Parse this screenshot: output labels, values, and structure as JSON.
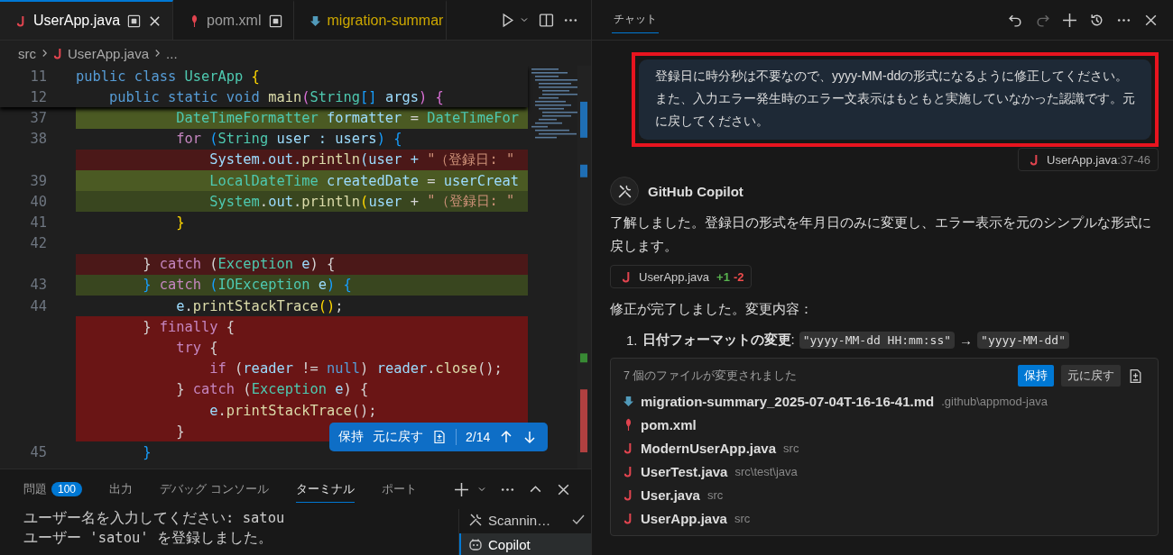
{
  "editor": {
    "tabs": [
      {
        "label": "UserApp.java",
        "kind": "java",
        "selected": true,
        "dirty": true,
        "closable": true
      },
      {
        "label": "pom.xml",
        "kind": "maven",
        "selected": false,
        "dirty": true,
        "closable": false
      },
      {
        "label": "migration-summar",
        "kind": "markdown",
        "selected": false,
        "dirty": false,
        "closable": false
      }
    ],
    "breadcrumb": {
      "folder": "src",
      "file": "UserApp.java",
      "more": "..."
    },
    "sticky_lines": [
      {
        "number": "11",
        "code": [
          {
            "text": "public class ",
            "kind": "kw"
          },
          {
            "text": "UserApp ",
            "kind": "type"
          },
          {
            "text": "{",
            "kind": "b1"
          }
        ]
      },
      {
        "number": "12",
        "code": [
          {
            "text": "    public static void ",
            "kind": "kw"
          },
          {
            "text": "main",
            "kind": "fn"
          },
          {
            "text": "(",
            "kind": "b2"
          },
          {
            "text": "String",
            "kind": "type"
          },
          {
            "text": "[]",
            "kind": "b3"
          },
          {
            "text": " args",
            "kind": "var"
          },
          {
            "text": ")",
            "kind": "b2"
          },
          {
            "text": " {",
            "kind": "b2"
          }
        ]
      }
    ],
    "lines": [
      {
        "number": "37",
        "kind": "added",
        "code": [
          {
            "text": "            DateTimeFormatter",
            "kind": "type"
          },
          {
            "text": " formatter",
            "kind": "var"
          },
          {
            "text": " = ",
            "kind": "punct"
          },
          {
            "text": "DateTimeFor",
            "kind": "type"
          }
        ]
      },
      {
        "number": "38",
        "code": [
          {
            "text": "            for ",
            "kind": "ctrl"
          },
          {
            "text": "(",
            "kind": "b3"
          },
          {
            "text": "String",
            "kind": "type"
          },
          {
            "text": " user : users",
            "kind": "var"
          },
          {
            "text": ") {",
            "kind": "b3"
          }
        ]
      },
      {
        "kind": "removed",
        "code": [
          {
            "text": "                System.out.",
            "kind": "var"
          },
          {
            "text": "println",
            "kind": "fn"
          },
          {
            "text": "(user + ",
            "kind": "var"
          },
          {
            "text": "\"（登録日: \"",
            "kind": "str"
          }
        ]
      },
      {
        "number": "39",
        "kind": "added",
        "code": [
          {
            "text": "                LocalDateTime",
            "kind": "type"
          },
          {
            "text": " createdDate",
            "kind": "var"
          },
          {
            "text": " = ",
            "kind": "punct"
          },
          {
            "text": "userCreat",
            "kind": "var"
          }
        ]
      },
      {
        "number": "40",
        "kind": "added-dim",
        "code": [
          {
            "text": "                System",
            "kind": "type"
          },
          {
            "text": ".",
            "kind": "punct"
          },
          {
            "text": "out",
            "kind": "var"
          },
          {
            "text": ".",
            "kind": "punct"
          },
          {
            "text": "println",
            "kind": "fn"
          },
          {
            "text": "(",
            "kind": "b1"
          },
          {
            "text": "user",
            "kind": "var"
          },
          {
            "text": " + ",
            "kind": "punct"
          },
          {
            "text": "\"（登録日: \"",
            "kind": "str"
          }
        ]
      },
      {
        "number": "41",
        "code": [
          {
            "text": "            }",
            "kind": "b1"
          }
        ]
      },
      {
        "number": "42"
      },
      {
        "kind": "removed",
        "code": [
          {
            "text": "        } ",
            "kind": "punct"
          },
          {
            "text": "catch",
            "kind": "ctrl"
          },
          {
            "text": " (",
            "kind": "punct"
          },
          {
            "text": "Exception",
            "kind": "type"
          },
          {
            "text": " e",
            "kind": "var"
          },
          {
            "text": ") {",
            "kind": "punct"
          }
        ]
      },
      {
        "number": "43",
        "kind": "added-dim",
        "code": [
          {
            "text": "        }",
            "kind": "b3"
          },
          {
            "text": " catch",
            "kind": "ctrl"
          },
          {
            "text": " (",
            "kind": "b3"
          },
          {
            "text": "IOException",
            "kind": "type"
          },
          {
            "text": " e",
            "kind": "var"
          },
          {
            "text": ") {",
            "kind": "b3"
          }
        ]
      },
      {
        "number": "44",
        "code": [
          {
            "text": "            e",
            "kind": "var"
          },
          {
            "text": ".",
            "kind": "punct"
          },
          {
            "text": "printStackTrace",
            "kind": "fn"
          },
          {
            "text": "()",
            "kind": "b1"
          },
          {
            "text": ";",
            "kind": "punct"
          }
        ]
      },
      {
        "kind": "removed-strong",
        "code": [
          {
            "text": "        } ",
            "kind": "punct"
          },
          {
            "text": "finally",
            "kind": "ctrl"
          },
          {
            "text": " {",
            "kind": "punct"
          }
        ]
      },
      {
        "kind": "removed-strong",
        "code": [
          {
            "text": "            try",
            "kind": "ctrl"
          },
          {
            "text": " {",
            "kind": "punct"
          }
        ]
      },
      {
        "kind": "removed-strong",
        "code": [
          {
            "text": "                if",
            "kind": "ctrl"
          },
          {
            "text": " (",
            "kind": "punct"
          },
          {
            "text": "reader",
            "kind": "var"
          },
          {
            "text": " != ",
            "kind": "punct"
          },
          {
            "text": "null",
            "kind": "kw"
          },
          {
            "text": ") ",
            "kind": "punct"
          },
          {
            "text": "reader",
            "kind": "var"
          },
          {
            "text": ".",
            "kind": "punct"
          },
          {
            "text": "close",
            "kind": "fn"
          },
          {
            "text": "();",
            "kind": "punct"
          }
        ]
      },
      {
        "kind": "removed-strong",
        "code": [
          {
            "text": "            } ",
            "kind": "punct"
          },
          {
            "text": "catch",
            "kind": "ctrl"
          },
          {
            "text": " (",
            "kind": "punct"
          },
          {
            "text": "Exception",
            "kind": "type"
          },
          {
            "text": " e",
            "kind": "var"
          },
          {
            "text": ") {",
            "kind": "punct"
          }
        ]
      },
      {
        "kind": "removed-strong",
        "code": [
          {
            "text": "                e",
            "kind": "var"
          },
          {
            "text": ".",
            "kind": "punct"
          },
          {
            "text": "printStackTrace",
            "kind": "fn"
          },
          {
            "text": "();",
            "kind": "punct"
          }
        ]
      },
      {
        "kind": "removed-strong",
        "code": [
          {
            "text": "            }",
            "kind": "punct"
          }
        ]
      },
      {
        "number": "45",
        "code": [
          {
            "text": "        }",
            "kind": "b3"
          }
        ]
      }
    ],
    "diff_toolbar": {
      "keep": "保持",
      "undo": "元に戻す",
      "position": "2/14"
    }
  },
  "panel": {
    "tabs": [
      {
        "label": "問題",
        "badge": "100",
        "selected": false
      },
      {
        "label": "出力",
        "selected": false
      },
      {
        "label": "デバッグ コンソール",
        "selected": false
      },
      {
        "label": "ターミナル",
        "selected": true
      },
      {
        "label": "ポート",
        "selected": false
      }
    ],
    "terminal_lines": [
      "ユーザー名を入力してください: satou",
      "ユーザー 'satou' を登録しました。"
    ],
    "terminals": [
      {
        "kind": "tools",
        "label": "Scannin…",
        "done": true,
        "selected": false
      },
      {
        "kind": "copilot",
        "label": "Copilot",
        "done": false,
        "selected": true
      }
    ]
  },
  "chat": {
    "tab": "チャット",
    "user_message": "登録日に時分秒は不要なので、yyyy-MM-ddの形式になるように修正してください。また、入力エラー発生時のエラー文表示はもともと実施していなかった認識です。元に戻してください。",
    "reference": {
      "file": "UserApp.java",
      "range": ":37-46"
    },
    "assistant": "GitHub Copilot",
    "reply": "了解しました。登録日の形式を年月日のみに変更し、エラー表示を元のシンプルな形式に戻します。",
    "edit_chip": {
      "file": "UserApp.java",
      "added": "+1",
      "removed": "-2"
    },
    "summary": "修正が完了しました。変更内容：",
    "changes": [
      {
        "number": "1.",
        "heading": "**日付フォーマットの変更**:",
        "before": "\"yyyy-MM-dd HH:mm:ss\"",
        "arrow": "→",
        "after": "\"yyyy-MM-dd\""
      }
    ],
    "changed_files": {
      "title": "7 個のファイルが変更されました",
      "keep": "保持",
      "undo": "元に戻す",
      "files": [
        {
          "kind": "markdown",
          "name": "migration-summary_2025-07-04T-16-16-41.md",
          "path": ".github\\appmod-java"
        },
        {
          "kind": "maven",
          "name": "pom.xml"
        },
        {
          "kind": "java",
          "name": "ModernUserApp.java",
          "path": "src"
        },
        {
          "kind": "java",
          "name": "UserTest.java",
          "path": "src\\test\\java"
        },
        {
          "kind": "java",
          "name": "User.java",
          "path": "src"
        },
        {
          "kind": "java",
          "name": "UserApp.java",
          "path": "src"
        }
      ]
    }
  }
}
